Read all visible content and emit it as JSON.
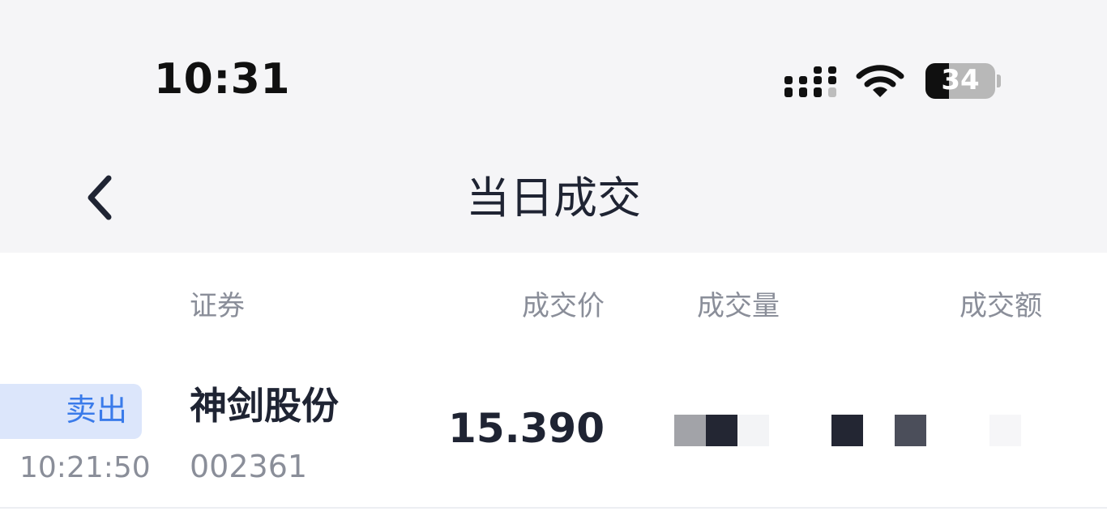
{
  "status_bar": {
    "time": "10:31",
    "icons": [
      "signal-icon",
      "wifi-icon",
      "battery-icon"
    ],
    "battery_level": "34",
    "battery_percent": 34
  },
  "nav": {
    "back_icon": "chevron-left-icon",
    "title": "当日成交"
  },
  "table": {
    "headers": {
      "security": "证券",
      "price": "成交价",
      "volume": "成交量",
      "amount": "成交额"
    },
    "rows": [
      {
        "side": "卖出",
        "time": "10:21:50",
        "name": "神剑股份",
        "code": "002361",
        "price": "15.390",
        "volume_obscured": true,
        "amount_obscured": true
      }
    ]
  },
  "colors": {
    "background_top": "#f5f5f7",
    "background_list": "#ffffff",
    "text_primary": "#1f2433",
    "text_secondary": "#8a8e99",
    "sell_badge_bg": "#dce6fb",
    "sell_badge_text": "#3a7bea"
  }
}
